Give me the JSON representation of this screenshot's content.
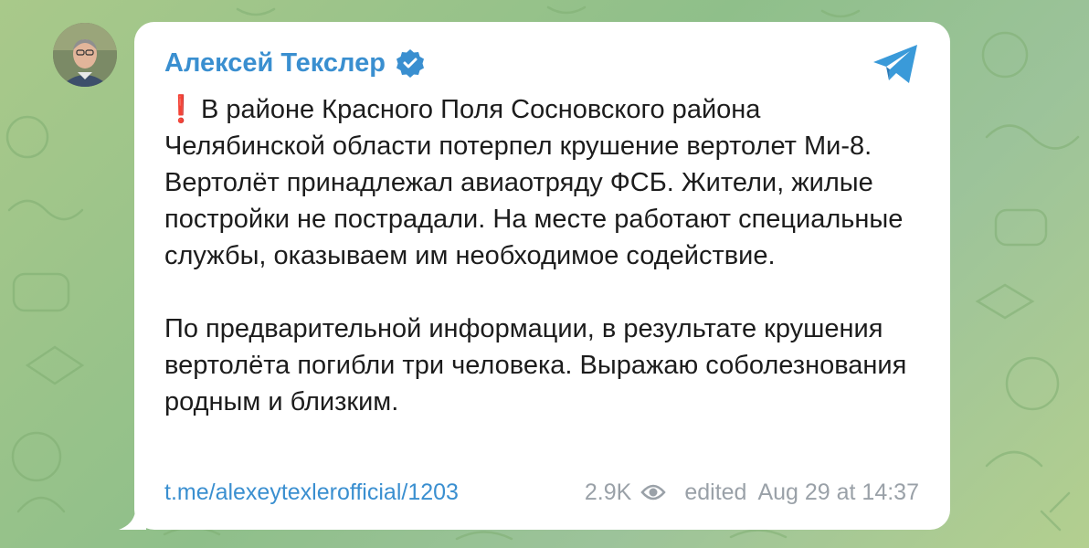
{
  "post": {
    "author": "Алексей Текслер",
    "paragraphs": [
      "В районе Красного Поля Сосновского района Челябинской области потерпел крушение вертолет Ми-8. Вертолёт принадлежал авиаотряду ФСБ. Жители, жилые постройки не пострадали. На месте работают специальные службы, оказываем им необходимое содействие.",
      "По предварительной информации, в результате крушения вертолёта погибли три человека. Выражаю соболезнования родным и близким."
    ],
    "emphasis_mark": "❗",
    "link": "t.me/alexeytexlerofficial/1203",
    "views": "2.9K",
    "edited_label": "edited",
    "date": "Aug 29 at 14:37"
  },
  "colors": {
    "accent": "#3a8fd0",
    "meta_gray": "#9aa1a8",
    "exclamation": "#e52b2b"
  },
  "icons": [
    "telegram-icon",
    "verified-badge-icon",
    "eye-icon",
    "avatar"
  ]
}
